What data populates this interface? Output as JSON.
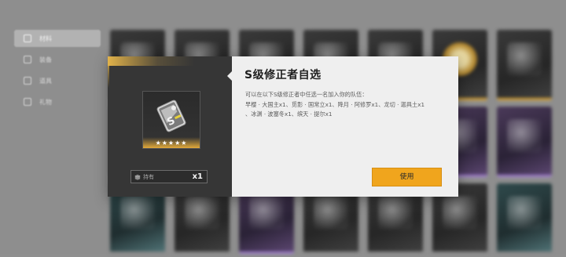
{
  "sidebar": {
    "items": [
      {
        "label": "材料",
        "active": true
      },
      {
        "label": "装备",
        "active": false
      },
      {
        "label": "道具",
        "active": false
      },
      {
        "label": "礼物",
        "active": false
      }
    ]
  },
  "dialog": {
    "title": "S级修正者自选",
    "description_line1": "可以在以下S级修正者中任选一名加入你的队伍：",
    "description_line2": "早樱 · 大国主x1、觅影 · 国常立x1、降月 · 阿修罗x1、龙切 · 迦具土x1",
    "description_line3": "、冰渊 · 波塞冬x1、缤天 · 提尔x1",
    "item_stars": "★★★★★",
    "owned_label": "持有",
    "owned_count": "x1",
    "use_button": "使用",
    "accent_color": "#f0a51d",
    "rarity_color": "#e1b24a"
  }
}
